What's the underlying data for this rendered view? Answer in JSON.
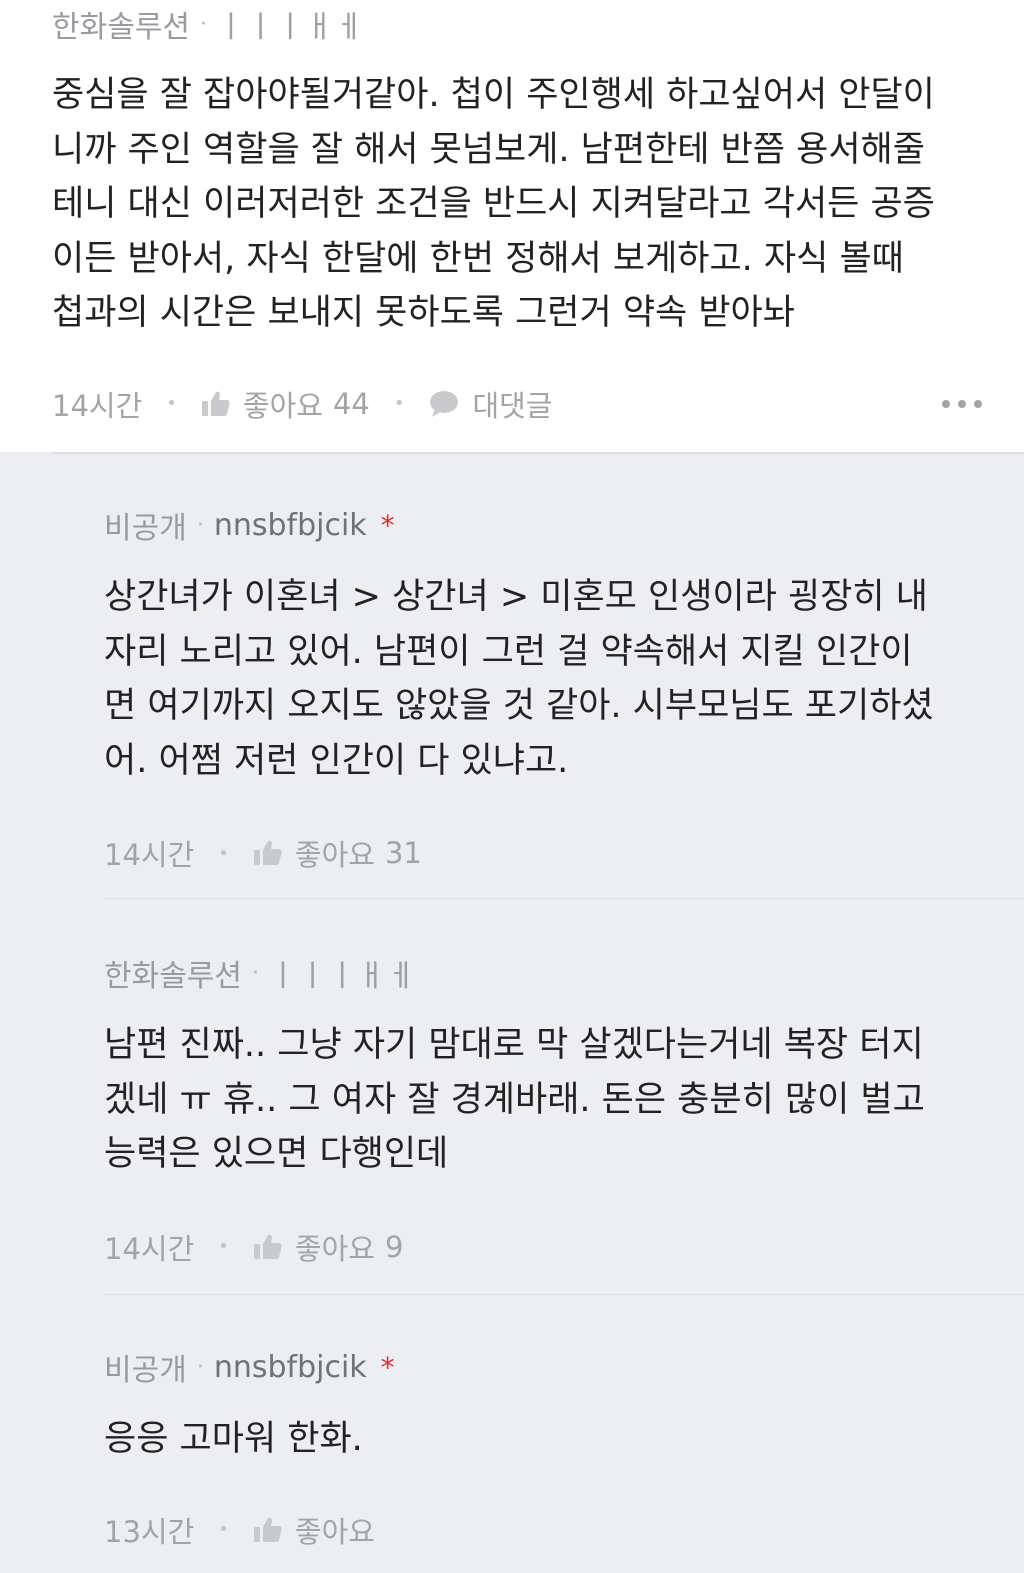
{
  "colors": {
    "background_top": "#ffffff",
    "background_replies": "#eceef1",
    "text": "#222222",
    "muted": "#a2a4a8",
    "required_star": "#e0322f"
  },
  "comment": {
    "author": "한화솔루션",
    "nickname": "ㅣㅣㅣㅐㅔ",
    "body": "중심을 잘 잡아야될거같아. 첩이 주인행세 하고싶어서 안달이\n니까 주인 역할을 잘 해서 못넘보게. 남편한테 반쯤 용서해줄\n테니 대신 이러저러한 조건을 반드시 지켜달라고 각서든 공증\n이든 받아서, 자식 한달에 한번 정해서 보게하고. 자식 볼때\n첩과의 시간은 보내지 못하도록 그런거 약속 받아놔",
    "time": "14시간",
    "like_label": "좋아요",
    "like_count": "44",
    "reply_label": "대댓글",
    "more_icon": "more-dots-icon"
  },
  "replies": [
    {
      "author": "비공개",
      "nickname": "nnsbfbjcik",
      "star": "*",
      "body": "상간녀가 이혼녀 > 상간녀 > 미혼모 인생이라 굉장히 내\n자리 노리고 있어. 남편이 그런 걸 약속해서 지킬 인간이\n면 여기까지 오지도 않았을 것 같아. 시부모님도 포기하셨\n어. 어쩜 저런 인간이 다 있냐고.",
      "time": "14시간",
      "like_label": "좋아요",
      "like_count": "31"
    },
    {
      "author": "한화솔루션",
      "nickname": "ㅣㅣㅣㅐㅔ",
      "body": "남편 진짜.. 그냥 자기 맘대로 막 살겠다는거네 복장 터지\n겠네 ㅠ 휴.. 그 여자 잘 경계바래. 돈은 충분히 많이 벌고\n능력은 있으면 다행인데",
      "time": "14시간",
      "like_label": "좋아요",
      "like_count": "9"
    },
    {
      "author": "비공개",
      "nickname": "nnsbfbjcik",
      "star": "*",
      "body": "응응 고마워 한화.",
      "time": "13시간",
      "like_label": "좋아요",
      "like_count": ""
    }
  ]
}
